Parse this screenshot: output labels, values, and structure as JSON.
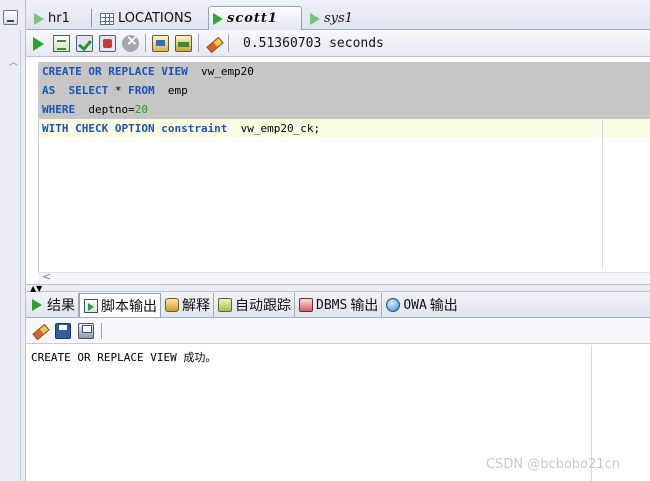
{
  "tabs": [
    {
      "label": "hr1",
      "icon": "sql-worksheet-icon"
    },
    {
      "label": "LOCATIONS",
      "icon": "table-grid-icon"
    },
    {
      "label": "scott1",
      "icon": "sql-worksheet-icon",
      "active": true
    },
    {
      "label": "sys1",
      "icon": "sql-worksheet-icon"
    }
  ],
  "toolbar": {
    "timing": "0.51360703 seconds"
  },
  "editor": {
    "lines": [
      {
        "keyword_1": "CREATE OR REPLACE VIEW",
        "rest": "  vw_emp20"
      },
      {
        "keyword_1": "AS",
        "gap": "  ",
        "keyword_2": "SELECT",
        "mid": " * ",
        "keyword_3": "FROM",
        "rest": "  emp"
      },
      {
        "keyword_1": "WHERE",
        "rest": "  deptno=",
        "number": "20"
      },
      {
        "keyword_1": "WITH CHECK OPTION constraint",
        "rest": "  vw_emp20_ck;"
      }
    ]
  },
  "bottom_tabs": [
    {
      "label": "结果"
    },
    {
      "label": "脚本输出",
      "active": true
    },
    {
      "label": "解释"
    },
    {
      "label": "自动跟踪"
    },
    {
      "label_mono": "DBMS",
      "label": " 输出"
    },
    {
      "label_mono": "OWA",
      "label": " 输出"
    }
  ],
  "output": {
    "text": "CREATE OR REPLACE VIEW 成功。"
  },
  "watermark": "CSDN @bcbobo21cn",
  "colors": {
    "keyword": "#1d52b8",
    "number": "#20a020",
    "selection": "#c6c6c6",
    "current_line": "#fcfbe3"
  }
}
